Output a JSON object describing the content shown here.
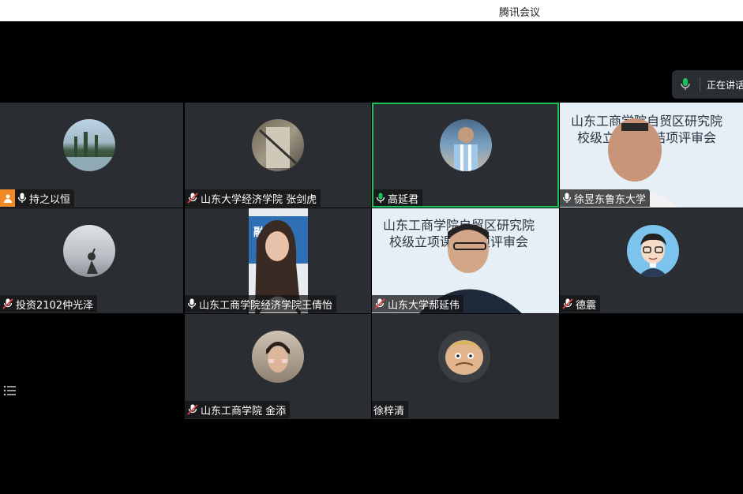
{
  "window": {
    "title": "腾讯会议"
  },
  "speaking": {
    "label": "正在讲话"
  },
  "participants": [
    {
      "name": "持之以恒",
      "mic": "on"
    },
    {
      "name": "山东大学经济学院 张剑虎",
      "mic": "muted"
    },
    {
      "name": "高延君",
      "mic": "active"
    },
    {
      "name": "徐昱东鲁东大学",
      "mic": "on"
    },
    {
      "name": "投资2102仲光泽",
      "mic": "muted"
    },
    {
      "name": "山东工商学院经济学院王倩怡",
      "mic": "on"
    },
    {
      "name": "山东大学郝延伟",
      "mic": "muted"
    },
    {
      "name": "德震",
      "mic": "muted"
    },
    {
      "name": "山东工商学院 金添",
      "mic": "muted"
    },
    {
      "name": "徐梓清",
      "mic": "none"
    }
  ],
  "slides": {
    "tile4_line1": "山东工商学院自贸区研究院",
    "tile4_line2": "校级立项课题结项评审会",
    "tile7_line1": "山东工商学院自贸区研究院",
    "tile7_line2": "校级立项课题结项评审会",
    "tile6_text": "融科 防"
  },
  "colors": {
    "active_border": "#19c35a",
    "mic_green": "#19c35a",
    "tile_bg": "#2a2d31",
    "badge_orange": "#f08a24"
  },
  "icons": [
    "mic-icon",
    "mic-muted-icon",
    "person-icon",
    "list-icon"
  ]
}
